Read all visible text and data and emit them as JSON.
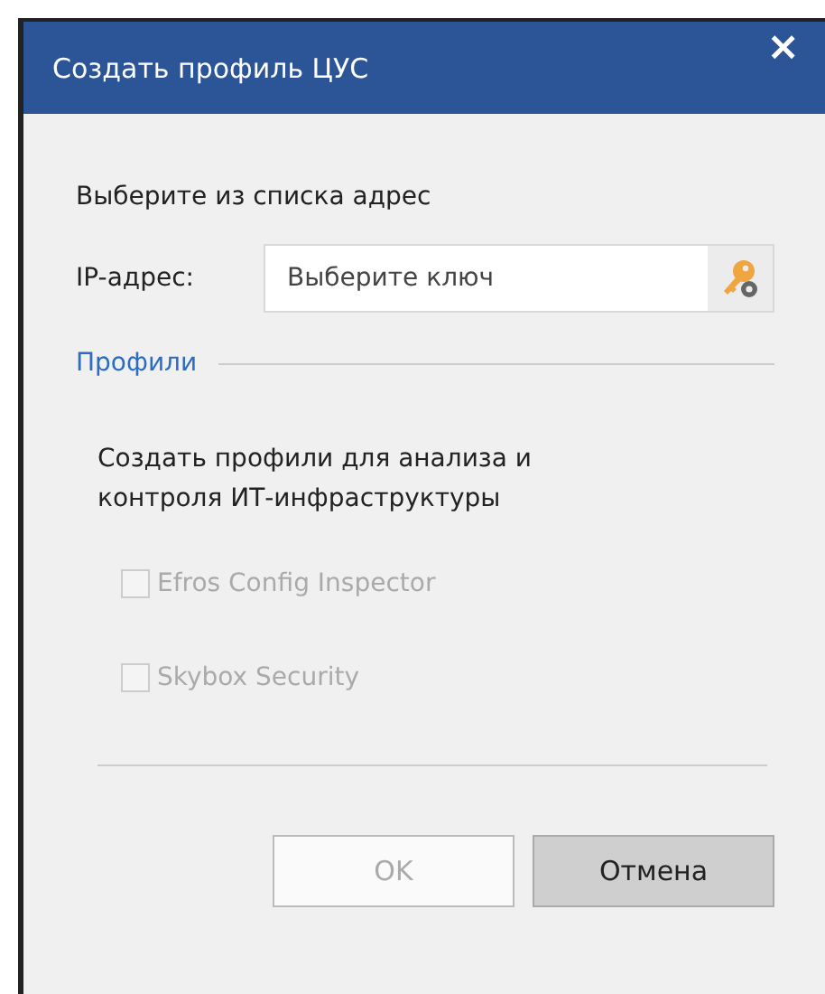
{
  "window": {
    "title": "Создать профиль ЦУС",
    "close": "×"
  },
  "prompt": "Выберите из списка адрес",
  "ip_field": {
    "label": "IP-адрес:",
    "placeholder": "Выберите ключ"
  },
  "section": {
    "title": "Профили"
  },
  "description": "Создать профили для анализа и контроля ИТ-инфраструктуры",
  "checkboxes": [
    {
      "label": "Efros Config Inspector",
      "checked": false,
      "disabled": true
    },
    {
      "label": "Skybox Security",
      "checked": false,
      "disabled": true
    }
  ],
  "buttons": [
    {
      "label": "OK",
      "disabled": true
    },
    {
      "label": "Отмена",
      "disabled": false
    }
  ]
}
